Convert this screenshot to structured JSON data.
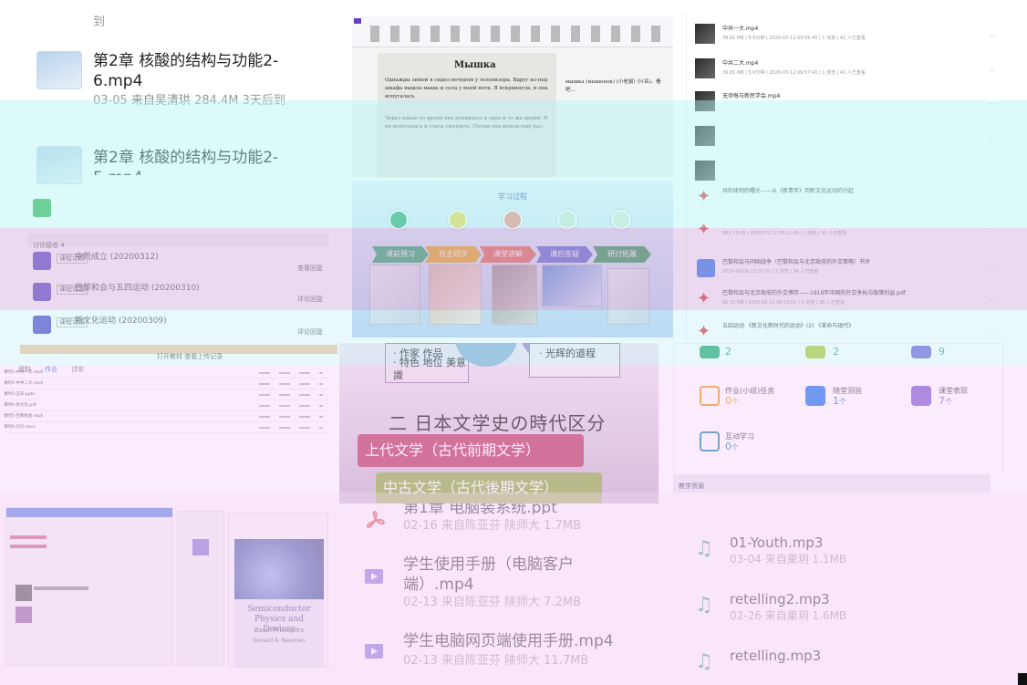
{
  "left_top": {
    "partial_top": "到",
    "files": [
      {
        "name": "第2章 核酸的结构与功能2-6.mp4",
        "date": "03-05",
        "from": "来自吴清珙",
        "size": "284.4M",
        "expire": "3天后到"
      },
      {
        "name": "第2章 核酸的结构与功能2-5.mp4"
      }
    ],
    "discussion_header": "讨论接收 4",
    "discussions": [
      {
        "tag": "课程话题",
        "title": "中药成立 (20200312)",
        "action": "查看回复"
      },
      {
        "tag": "课程话题",
        "title": "巴黎和会与五四运动 (20200310)",
        "action": "评论回复"
      },
      {
        "tag": "课程话题",
        "title": "新文化运动 (20200309)",
        "action": "评论回复"
      }
    ]
  },
  "doc_viewer": {
    "title": "Мышка",
    "para1": "Однажды зимой я сидел вечером у телевизора. Вдруг из-под шкафа вышла мышь и села у моей ноги. Я вскрикнула, и она испугалась",
    "para2": "Через какое-то время она появилась в одно и то же время. Я не испугалась и стала смотреть. Потом она вошла ещё раз.",
    "right_note": "мышка (мышонок) (小老鼠) 小(名)。看吧…"
  },
  "process": {
    "title": "学习过程",
    "steps": [
      "课前预习",
      "自主研学",
      "课堂讲解",
      "课后答疑",
      "研讨拓展"
    ],
    "colors": [
      "#2eaa6f",
      "#e4a91c",
      "#e06a55",
      "#5a6bd0",
      "#2e9a56"
    ]
  },
  "japanese": {
    "bullet1": "· 作家  作品",
    "bullet2": "· 特色  地位  美意識",
    "bullet_right": "· 光辉的道程",
    "heading": "二  日本文学史の時代区分",
    "era1": "上代文学（古代前期文学）",
    "era2": "中古文学（古代後期文学）"
  },
  "middle_files": [
    {
      "name": "第1章 电脑装系统.ppt",
      "meta": "02-16 来自陈亚芬 陕师大 1.7MB",
      "icon": "pdf-icon"
    },
    {
      "name": "学生使用手册（电脑客户端）.mp4",
      "meta": "02-13 来自陈亚芬 陕师大 7.2MB",
      "icon": "play-icon"
    },
    {
      "name": "学生电脑网页端使用手册.mp4",
      "meta": "02-13 来自陈亚芬 陕师大 11.7MB",
      "icon": "play-icon"
    }
  ],
  "right_top": {
    "items": [
      {
        "name": "中共一大.mp4",
        "meta": "39.61 MB | 5.6分钟 | 2020-03-12 09:55:45 | 1 浏览 | 41 人已查看"
      },
      {
        "name": "中共二大.mp4",
        "meta": "39.61 MB | 5.6分钟 | 2020-03-12 09:57:41 | 1 浏览 | 41 人已查看"
      },
      {
        "name": "无须每与新民学会.mp4",
        "meta": ""
      },
      {
        "name": "",
        "meta": ""
      },
      {
        "name": "",
        "meta": ""
      },
      {
        "name": "共和体制的曙光——从《新青年》到新文化运动的兴起",
        "meta": ""
      },
      {
        "name": "",
        "meta": "892.73 KB | 2020-03-12 09:11:49 | 2 浏览 | 35 人已查看"
      },
      {
        "name": "巴黎和会与同国战争（巴黎和会与北京政府的外交策略）书评",
        "meta": "2020-03-09 12:37:01 | 1 浏览 | 34 人已查看"
      },
      {
        "name": "巴黎和会与北京政府的外交博弈——1919年中国的外交争执与政策利益.pdf",
        "meta": "65.33 MB | 2020-03-12 09:13:01 | 2 浏览 | 35 人已查看"
      },
      {
        "name": "五四运动 《新文化新时代的运动》(2) 《革命与现代》",
        "meta": ""
      }
    ]
  },
  "stats": [
    {
      "label": "作业(小组)任务",
      "value": "0",
      "unit": "个",
      "color": "#f0a020"
    },
    {
      "label": "随堂测验",
      "value": "1",
      "unit": "个",
      "color": "#2f80ed"
    },
    {
      "label": "课堂表现",
      "value": "7",
      "unit": "个",
      "color": "#8a6ad6"
    },
    {
      "label": "互动学习",
      "value": "0",
      "unit": "个",
      "color": "#3a8fb7"
    }
  ],
  "stats_top_values": [
    "2",
    "2",
    "9"
  ],
  "section_label": "教学资源",
  "audio_files": [
    {
      "name": "01-Youth.mp3",
      "meta": "03-04 来自巢玥 1.1MB"
    },
    {
      "name": "retelling2.mp3",
      "meta": "02-26 来自巢玥 1.6MB"
    },
    {
      "name": "retelling.mp3",
      "meta": ""
    }
  ],
  "left_bottom": {
    "bar_title": "打开教材 查看上传记录",
    "tabs": [
      "资料",
      "作业",
      "讨论"
    ],
    "rows": [
      "课时1-中共一大.mp4",
      "课时2-中共二大.mp4",
      "课时3-五四.pptx",
      "课时4-新文化.pdf",
      "课时5-巴黎和会.mp4",
      "课时6-讨论.docx"
    ]
  },
  "book": {
    "title": "Semiconductor Physics and Devices",
    "subtitle": "Basic Principles",
    "author": "Donald A. Neamen"
  }
}
